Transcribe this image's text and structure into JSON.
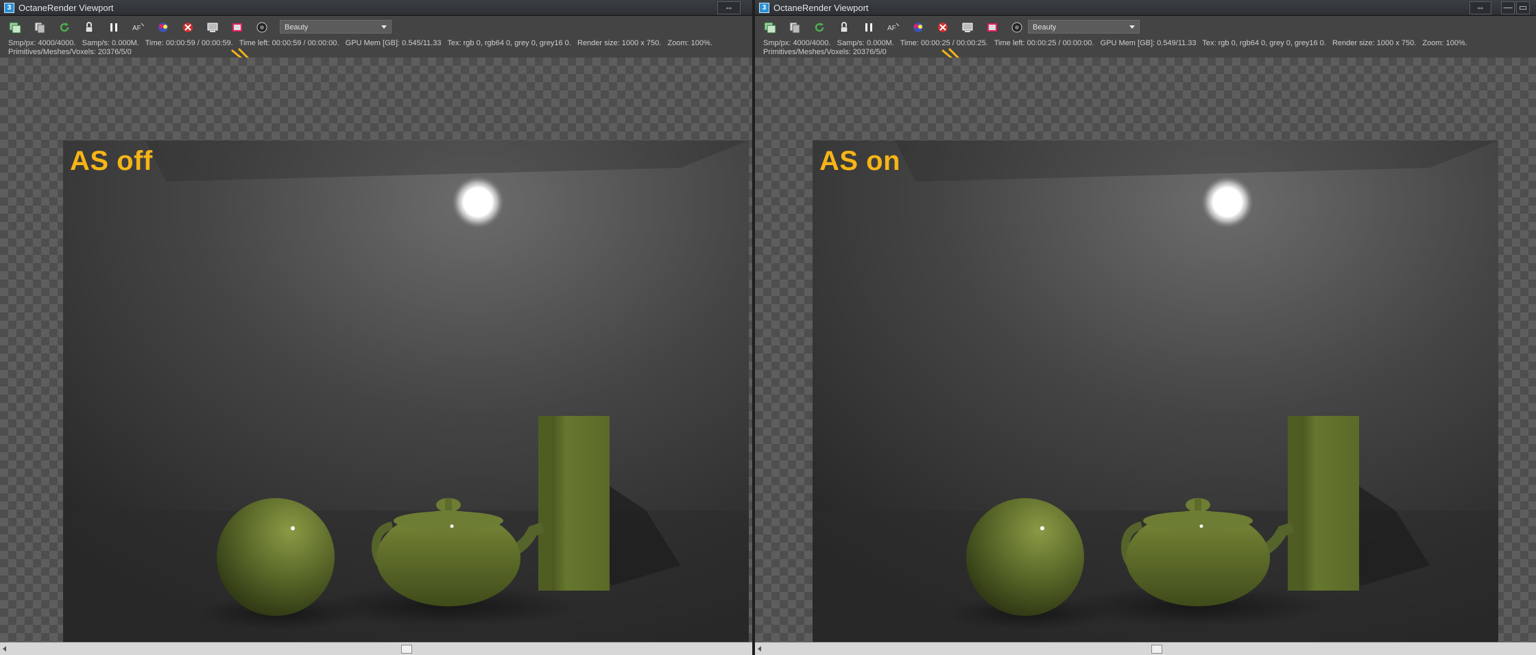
{
  "left": {
    "window_title": "OctaneRender Viewport",
    "app_icon": "3",
    "pass": "Beauty",
    "stats_line1": "Smp/px: 4000/4000.   Samp/s: 0.000M.   Time: 00:00:59 / 00:00:59.   Time left: 00:00:59 / 00:00:00.   GPU Mem [GB]: 0.545/11.33   Tex: rgb 0, rgb64 0, grey 0, grey16 0.   Render size: 1000 x 750.   Zoom: 100%.",
    "stats_line2": "Primitives/Meshes/Voxels: 20376/5/0",
    "label": "AS off",
    "window_buttons": [
      "⇔"
    ]
  },
  "right": {
    "window_title": "OctaneRender Viewport",
    "app_icon": "3",
    "pass": "Beauty",
    "stats_line1": "Smp/px: 4000/4000.   Samp/s: 0.000M.   Time: 00:00:25 / 00:00:25.   Time left: 00:00:25 / 00:00:00.   GPU Mem [GB]: 0.549/11.33   Tex: rgb 0, rgb64 0, grey 0, grey16 0.   Render size: 1000 x 750.   Zoom: 100%.",
    "stats_line2": "Primitives/Meshes/Voxels: 20376/5/0",
    "label": "AS on",
    "window_buttons": [
      "⇔",
      "—",
      "▭"
    ]
  },
  "toolbar_icons": [
    "send-scene-icon",
    "copy-icon",
    "restart-render-icon",
    "lock-icon",
    "pause-icon",
    "af-focus-icon",
    "color-picker-icon",
    "clear-icon",
    "region-render-icon",
    "film-settings-icon",
    "camera-icon"
  ],
  "colors": {
    "accent_label": "#f6b416",
    "pointer": "#f6b416",
    "object_green": "#5c6b2a",
    "window_bg": "#444444"
  }
}
